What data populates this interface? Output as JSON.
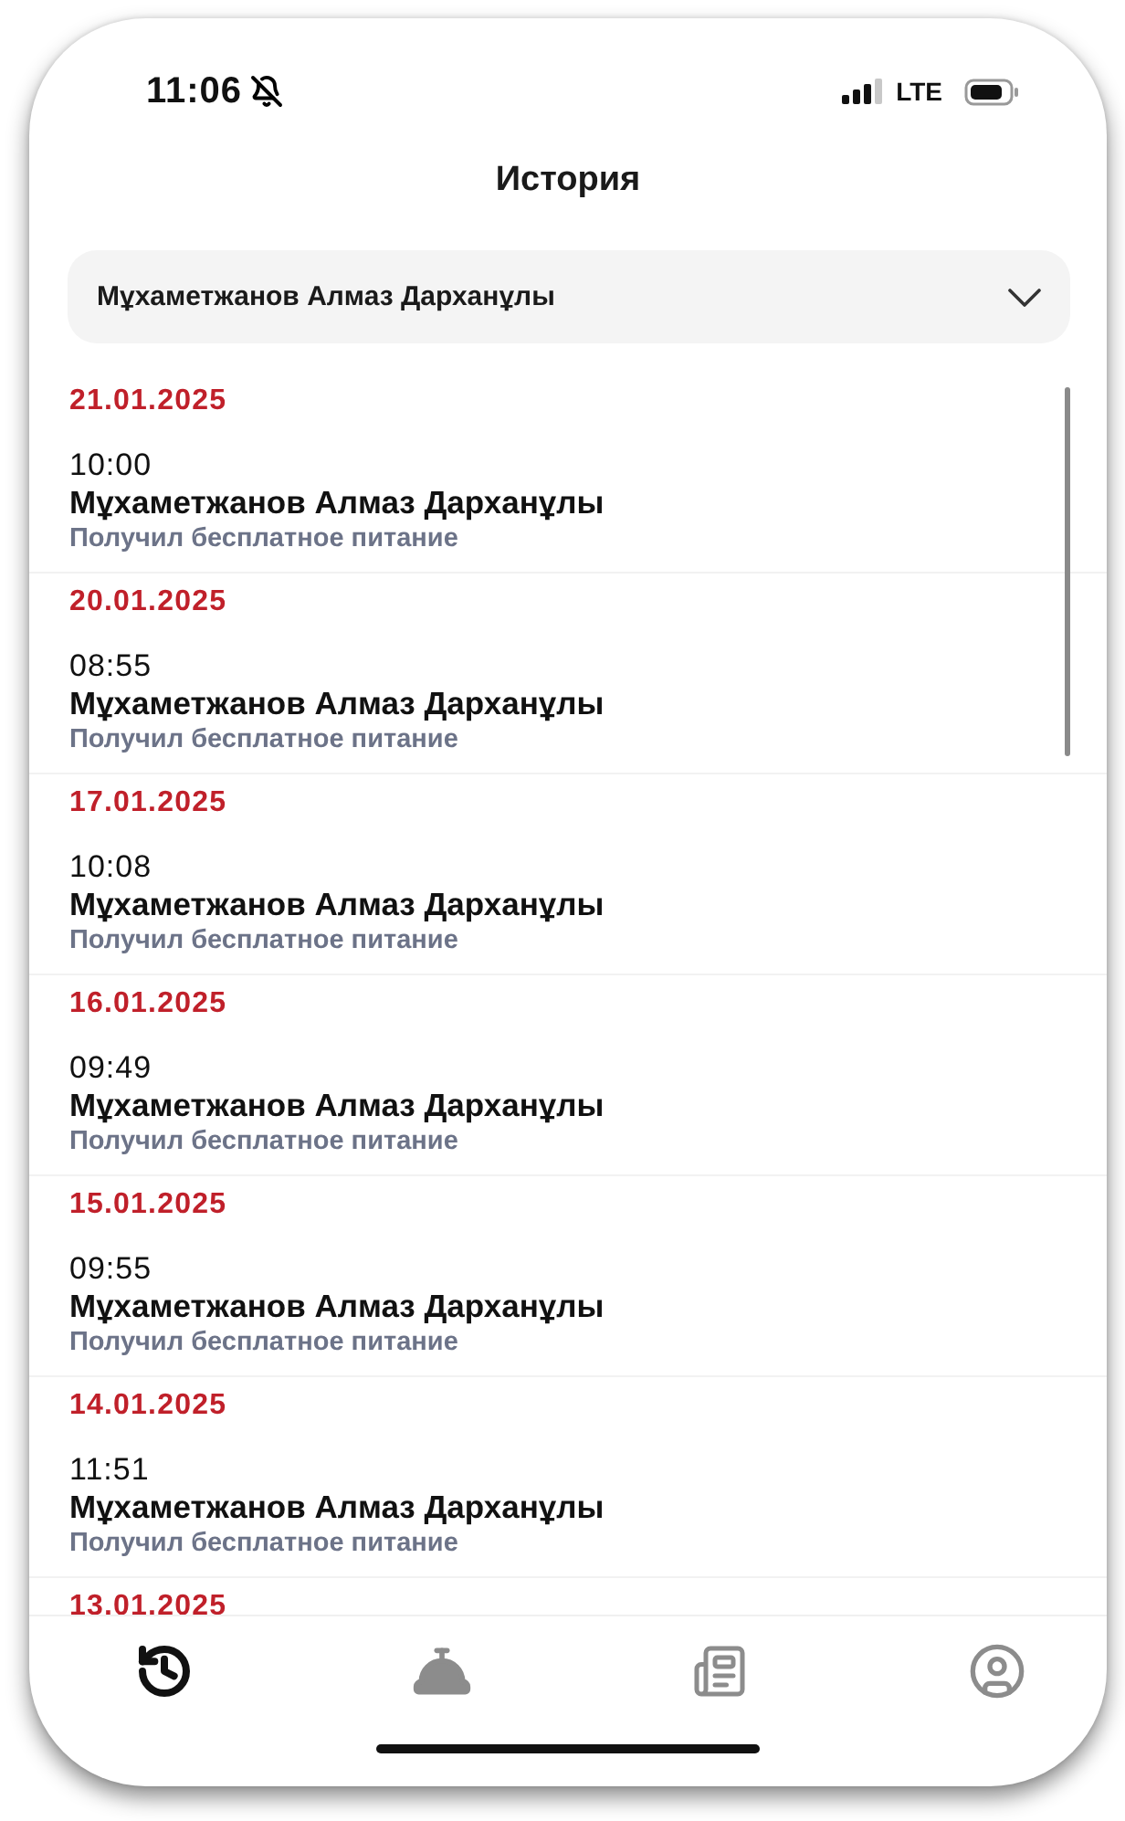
{
  "status_bar": {
    "time": "11:06",
    "network": "LTE"
  },
  "header": {
    "title": "История"
  },
  "selector": {
    "value": "Мұхаметжанов Алмаз Дарханұлы"
  },
  "history": [
    {
      "date": "21.01.2025",
      "time": "10:00",
      "name": "Мұхаметжанов Алмаз Дарханұлы",
      "event": "Получил бесплатное питание"
    },
    {
      "date": "20.01.2025",
      "time": "08:55",
      "name": "Мұхаметжанов Алмаз Дарханұлы",
      "event": "Получил бесплатное питание"
    },
    {
      "date": "17.01.2025",
      "time": "10:08",
      "name": "Мұхаметжанов Алмаз Дарханұлы",
      "event": "Получил бесплатное питание"
    },
    {
      "date": "16.01.2025",
      "time": "09:49",
      "name": "Мұхаметжанов Алмаз Дарханұлы",
      "event": "Получил бесплатное питание"
    },
    {
      "date": "15.01.2025",
      "time": "09:55",
      "name": "Мұхаметжанов Алмаз Дарханұлы",
      "event": "Получил бесплатное питание"
    },
    {
      "date": "14.01.2025",
      "time": "11:51",
      "name": "Мұхаметжанов Алмаз Дарханұлы",
      "event": "Получил бесплатное питание"
    },
    {
      "date": "13.01.2025"
    }
  ],
  "tab_bar": [
    {
      "kind": "history",
      "selected": true
    },
    {
      "kind": "service",
      "selected": false
    },
    {
      "kind": "news",
      "selected": false
    },
    {
      "kind": "profile",
      "selected": false
    }
  ]
}
